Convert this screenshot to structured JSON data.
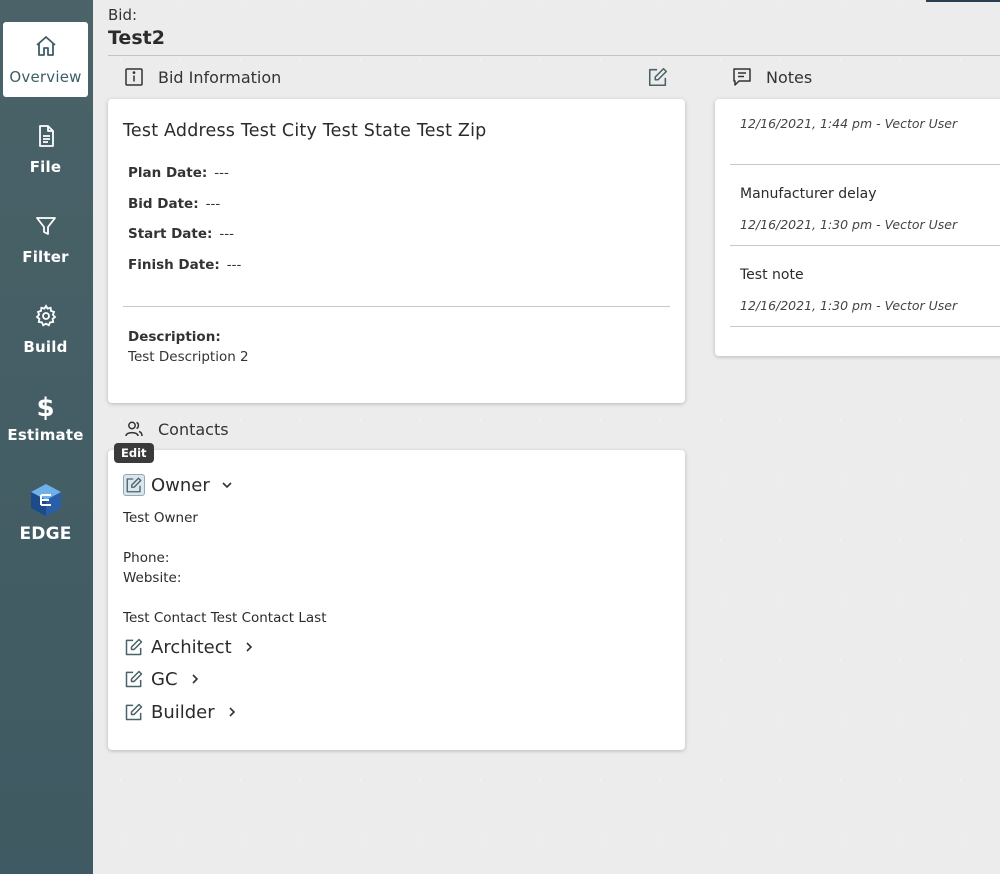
{
  "sidebar": {
    "items": [
      {
        "label": "Overview",
        "icon": "home-icon"
      },
      {
        "label": "File",
        "icon": "file-icon"
      },
      {
        "label": "Filter",
        "icon": "filter-icon"
      },
      {
        "label": "Build",
        "icon": "gear-icon"
      },
      {
        "label": "Estimate",
        "icon": "dollar-icon"
      },
      {
        "label": "EDGE",
        "icon": "edge-logo"
      }
    ],
    "active": "Overview"
  },
  "header": {
    "label": "Bid:",
    "title": "Test2"
  },
  "bid_info": {
    "heading": "Bid Information",
    "address": "Test Address Test City Test State Test Zip",
    "plan_date_label": "Plan Date:",
    "plan_date": "---",
    "bid_date_label": "Bid Date:",
    "bid_date": "---",
    "start_date_label": "Start Date:",
    "start_date": "---",
    "finish_date_label": "Finish Date:",
    "finish_date": "---",
    "description_label": "Description:",
    "description": "Test Description 2"
  },
  "contacts": {
    "heading": "Contacts",
    "tooltip": "Edit",
    "owner": {
      "label": "Owner",
      "name": "Test Owner",
      "phone_label": "Phone:",
      "website_label": "Website:",
      "contact": "Test Contact Test Contact Last"
    },
    "architect_label": "Architect",
    "gc_label": "GC",
    "builder_label": "Builder"
  },
  "notes": {
    "heading": "Notes",
    "items": [
      {
        "title": "",
        "meta": "12/16/2021, 1:44 pm - Vector User"
      },
      {
        "title": "Manufacturer delay",
        "meta": "12/16/2021, 1:30 pm - Vector User"
      },
      {
        "title": "Test note",
        "meta": "12/16/2021, 1:30 pm - Vector User"
      }
    ]
  },
  "colors": {
    "sidebar": "#4a6268",
    "accent": "#3e5d66",
    "card": "#ffffff",
    "background": "#ececec"
  }
}
